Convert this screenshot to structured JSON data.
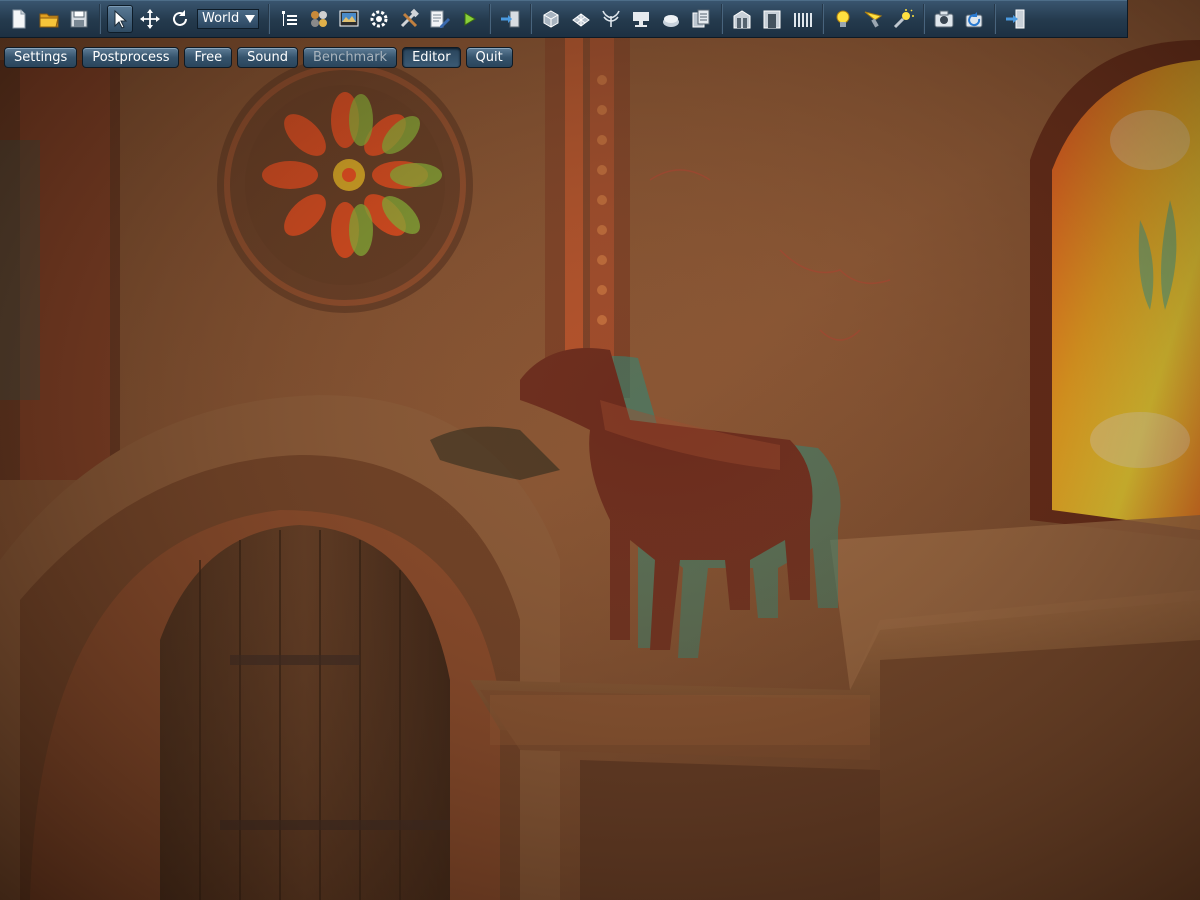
{
  "app": {
    "name": "3D engine editor viewport",
    "scene": "church interior with horse statue (anaglyph red/cyan stereo render)"
  },
  "toolbar": {
    "space_select": {
      "value": "World"
    },
    "icons": [
      "new-file-icon",
      "open-folder-icon",
      "save-icon",
      "select-cursor-icon",
      "move-icon",
      "rotate-icon",
      "node-tree-icon",
      "materials-icon",
      "viewport-icon",
      "properties-gear-icon",
      "tools-icon",
      "edit-script-icon",
      "play-icon",
      "import-icon",
      "box-object-icon",
      "mesh-icon",
      "particles-icon",
      "terrain-icon",
      "water-icon",
      "world-layers-icon",
      "sector-icon",
      "portal-icon",
      "occluder-icon",
      "light-icon",
      "projector-light-icon",
      "sun-icon",
      "camera-icon",
      "refresh-camera-icon",
      "exit-icon"
    ]
  },
  "menu": {
    "buttons": [
      {
        "label": "Settings",
        "state": "normal"
      },
      {
        "label": "Postprocess",
        "state": "normal"
      },
      {
        "label": "Free",
        "state": "normal"
      },
      {
        "label": "Sound",
        "state": "normal"
      },
      {
        "label": "Benchmark",
        "state": "disabled"
      },
      {
        "label": "Editor",
        "state": "pressed"
      },
      {
        "label": "Quit",
        "state": "normal"
      }
    ]
  },
  "colors": {
    "toolbar_bg": "#2a4358",
    "button_bg": "#3b5a74",
    "button_text": "#ffffff",
    "scene_tone": "#8a4a25"
  }
}
